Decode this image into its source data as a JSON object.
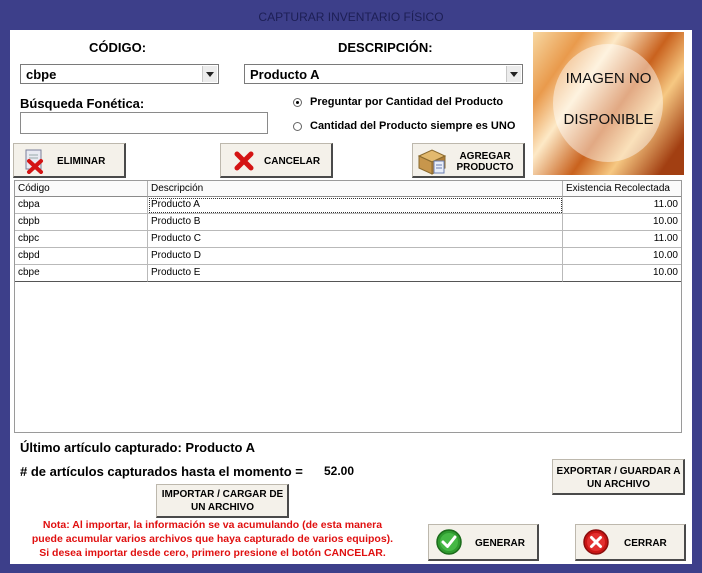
{
  "window": {
    "title": "CAPTURAR INVENTARIO FÍSICO"
  },
  "codigo": {
    "label": "CÓDIGO:",
    "value": "cbpe"
  },
  "descripcion": {
    "label": "DESCRIPCIÓN:",
    "value": "Producto A"
  },
  "busqueda": {
    "label": "Búsqueda Fonética:",
    "value": ""
  },
  "options": {
    "preguntar": "Preguntar por Cantidad del Producto",
    "siempre_uno": "Cantidad del Producto siempre es UNO",
    "selected": "preguntar"
  },
  "image": {
    "line1": "IMAGEN NO",
    "line2": "DISPONIBLE"
  },
  "buttons": {
    "eliminar": "ELIMINAR",
    "cancelar": "CANCELAR",
    "agregar_1": "AGREGAR",
    "agregar_2": "PRODUCTO",
    "exportar_1": "EXPORTAR / GUARDAR A",
    "exportar_2": "UN ARCHIVO",
    "importar_1": "IMPORTAR / CARGAR DE",
    "importar_2": "UN ARCHIVO",
    "generar": "GENERAR",
    "cerrar": "CERRAR"
  },
  "table": {
    "headers": [
      "Código",
      "Descripción",
      "Existencia Recolectada"
    ],
    "rows": [
      [
        "cbpa",
        "Producto A",
        "11.00"
      ],
      [
        "cbpb",
        "Producto B",
        "10.00"
      ],
      [
        "cbpc",
        "Producto C",
        "11.00"
      ],
      [
        "cbpd",
        "Producto D",
        "10.00"
      ],
      [
        "cbpe",
        "Producto E",
        "10.00"
      ]
    ]
  },
  "status": {
    "ultimo_label": "Último artículo capturado:",
    "ultimo_value": "Producto A",
    "count_label": "# de artículos capturados hasta el momento =",
    "count_value": "52.00"
  },
  "note": {
    "line1": "Nota: Al importar, la información se va acumulando (de esta manera",
    "line2": "puede acumular varios archivos que haya capturado de varios equipos).",
    "line3": "Si desea importar desde cero, primero presione el botón CANCELAR."
  },
  "colors": {
    "frame": "#3d3f8a",
    "note": "#e01010"
  }
}
